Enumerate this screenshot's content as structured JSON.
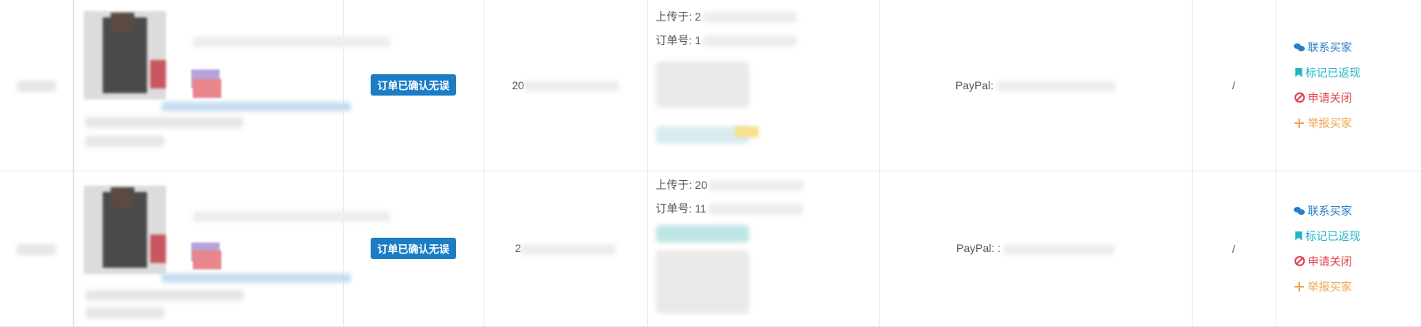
{
  "rows": [
    {
      "status_label": "订单已确认无误",
      "date_prefix": "20",
      "uploaded_label": "上传于: 2",
      "order_no_label": "订单号: 1",
      "paypal_label": "PayPal:",
      "slash": "/",
      "actions": {
        "contact": "联系买家",
        "mark": "标记已返现",
        "close": "申请关闭",
        "report": "举报买家"
      }
    },
    {
      "status_label": "订单已确认无误",
      "date_prefix": "2",
      "uploaded_label": "上传于: 20",
      "order_no_label": "订单号: 11",
      "paypal_label": "PayPal: :",
      "slash": "/",
      "actions": {
        "contact": "联系买家",
        "mark": "标记已返现",
        "close": "申请关闭",
        "report": "举报买家"
      }
    }
  ],
  "icons": {
    "contact": "chat-icon",
    "mark": "bookmark-icon",
    "close": "ban-icon",
    "report": "crosshair-icon"
  },
  "colors": {
    "status_button": "#1b7dc5",
    "contact": "#2a7cc7",
    "mark": "#1fb5c6",
    "close": "#e0434a",
    "report": "#f0a350"
  }
}
